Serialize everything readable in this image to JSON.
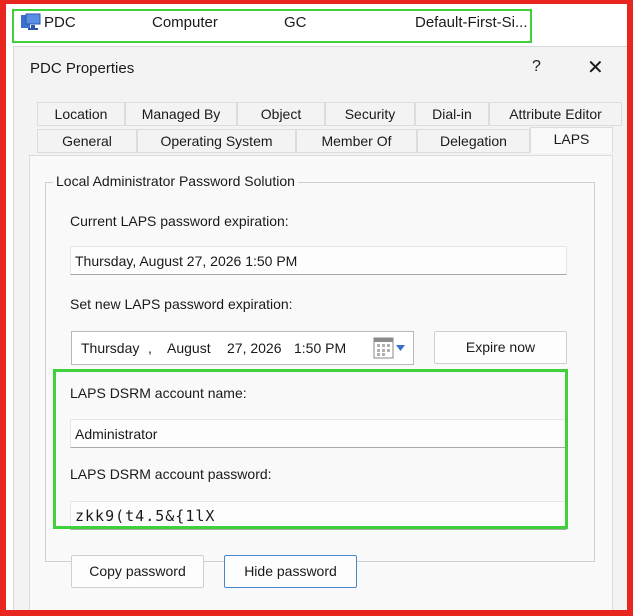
{
  "row": {
    "name": "PDC",
    "type": "Computer",
    "dc_type": "GC",
    "site": "Default-First-Si..."
  },
  "dialog": {
    "title": "PDC Properties",
    "help": "?",
    "close": "✕"
  },
  "tabs_row1": [
    "Location",
    "Managed By",
    "Object",
    "Security",
    "Dial-in",
    "Attribute Editor"
  ],
  "tabs_row2": [
    "General",
    "Operating System",
    "Member Of",
    "Delegation",
    "LAPS"
  ],
  "active_tab": "LAPS",
  "laps": {
    "group_title": "Local Administrator Password Solution",
    "current_expiration_label": "Current LAPS password expiration:",
    "current_expiration_value": "Thursday, August 27, 2026 1:50 PM",
    "new_expiration_label": "Set new LAPS password expiration:",
    "picker": {
      "weekday": "Thursday",
      "sep": ",",
      "month": "August",
      "day_year": "27, 2026",
      "time": "1:50 PM"
    },
    "expire_now": "Expire now",
    "dsrm_name_label": "LAPS DSRM account name:",
    "dsrm_name_value": "Administrator",
    "dsrm_password_label": "LAPS DSRM account password:",
    "dsrm_password_value": "zkk9(t4.5&{1lX",
    "copy_password": "Copy password",
    "hide_password": "Hide password"
  },
  "colors": {
    "highlight": "#3fd13a",
    "outer_border": "#e8251f",
    "button_focus": "#4c86c9"
  },
  "icons": [
    "computer-icon",
    "calendar-icon",
    "dropdown-arrow-icon"
  ]
}
